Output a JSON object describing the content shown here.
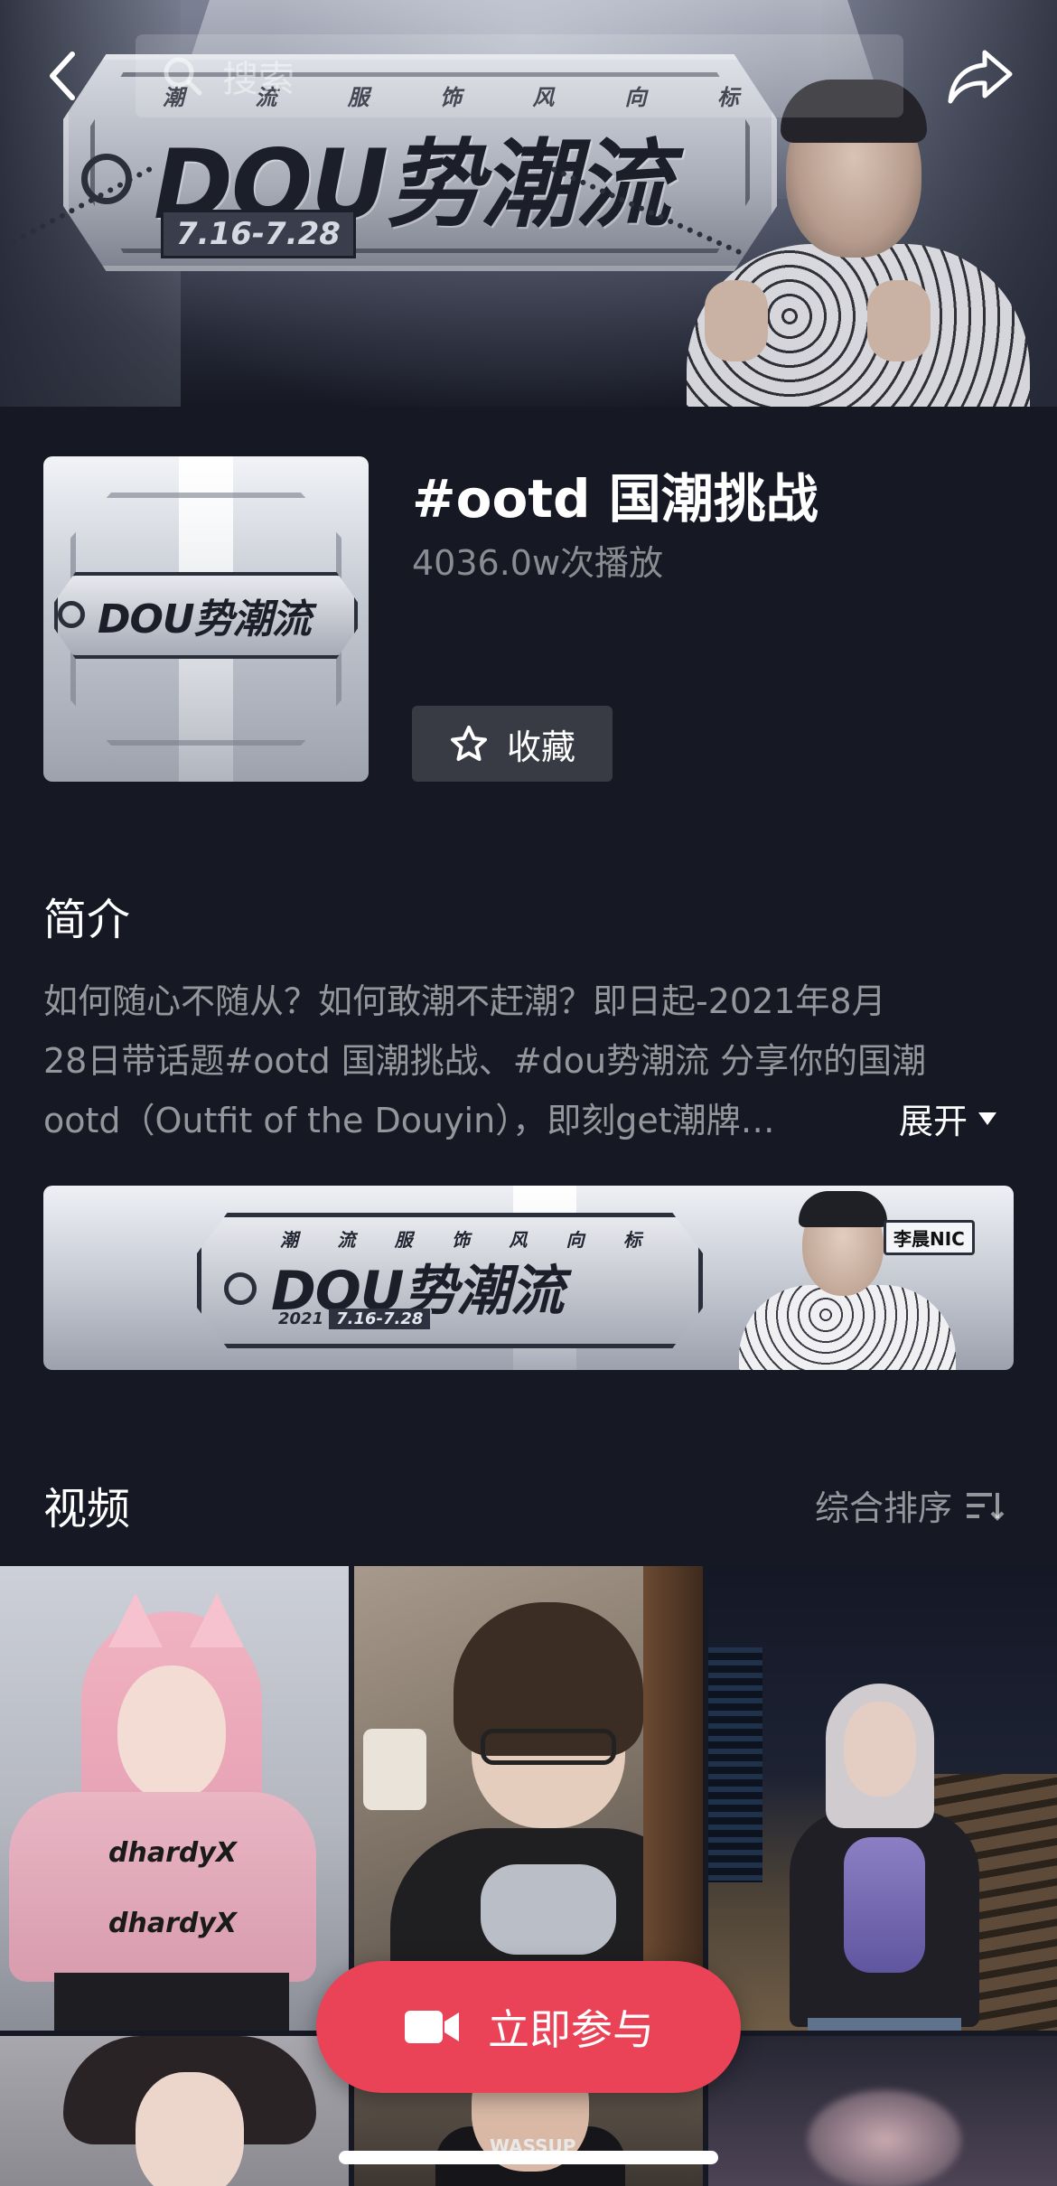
{
  "hero": {
    "banner_subtitle_chars": [
      "潮",
      "流",
      "服",
      "饰",
      "风",
      "向",
      "标"
    ],
    "banner_title": "DOU势潮流",
    "banner_date": "7.16-7.28"
  },
  "topbar": {
    "search_placeholder": "搜索",
    "back_icon": "chevron-left-icon",
    "share_icon": "share-arrow-icon"
  },
  "topic": {
    "cover_text": "DOU势潮流",
    "title": "#ootd 国潮挑战",
    "plays": "4036.0w次播放",
    "favorite_label": "收藏",
    "favorite_icon": "star-outline-icon"
  },
  "intro": {
    "heading": "简介",
    "lines": [
      "如何随心不随从？如何敢潮不赶潮？即日起-2021年8月",
      "28日带话题#ootd 国潮挑战、#dou势潮流 分享你的国潮",
      "ootd（Outfit of the Douyin），即刻get潮牌…"
    ],
    "expand_label": "展开",
    "expand_icon": "caret-down-icon"
  },
  "promo_banner": {
    "subtitle_chars": [
      "潮",
      "流",
      "服",
      "饰",
      "风",
      "向",
      "标"
    ],
    "title": "DOU势潮流",
    "year": "2021",
    "date": "7.16-7.28",
    "name_tag": "李晨NIC"
  },
  "videos": {
    "heading": "视频",
    "sort_label": "综合排序",
    "sort_icon": "sort-filter-icon",
    "tile1_shirt_text": "dhardyX",
    "tile5_print": "WASSUP"
  },
  "cta": {
    "label": "立即参与",
    "icon": "video-camera-icon",
    "color": "#ea4256"
  },
  "colors": {
    "background": "#161823",
    "accent": "#ea4256",
    "muted_text": "rgba(255,255,255,0.55)"
  }
}
